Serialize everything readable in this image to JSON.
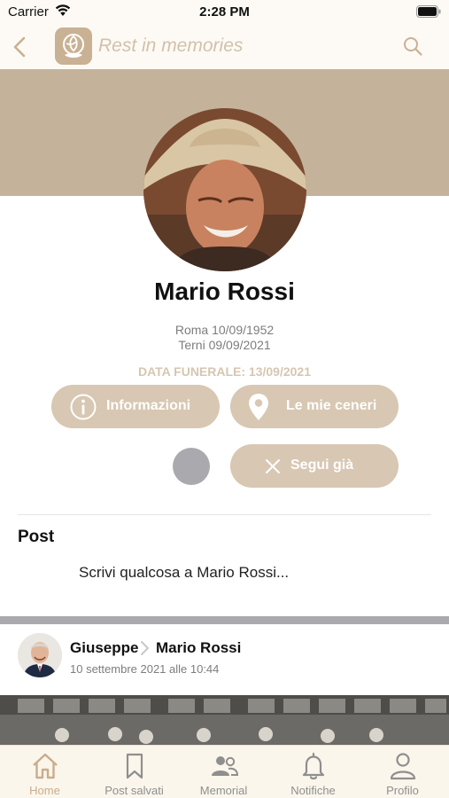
{
  "status_bar": {
    "carrier": "Carrier",
    "time": "2:28 PM"
  },
  "nav": {
    "title": "Rest in memories"
  },
  "profile": {
    "name": "Mario Rossi",
    "birth": "Roma 10/09/1952",
    "death": "Terni 09/09/2021",
    "funeral": "DATA FUNERALE: 13/09/2021"
  },
  "actions": {
    "info": "Informazioni",
    "ashes": "Le mie ceneri",
    "follow": "Segui già"
  },
  "post_section": {
    "heading": "Post",
    "prompt": "Scrivi qualcosa a Mario Rossi..."
  },
  "feed": {
    "author": "Giuseppe",
    "target": "Mario Rossi",
    "date": "10 settembre 2021 alle 10:44"
  },
  "tabs": [
    {
      "label": "Home",
      "icon": "home-icon",
      "active": true
    },
    {
      "label": "Post salvati",
      "icon": "bookmark-icon",
      "active": false
    },
    {
      "label": "Memorial",
      "icon": "people-icon",
      "active": false
    },
    {
      "label": "Notifiche",
      "icon": "bell-icon",
      "active": false
    },
    {
      "label": "Profilo",
      "icon": "person-icon",
      "active": false
    }
  ],
  "colors": {
    "accent": "#d8c7b2",
    "cover": "#c4b39a",
    "funeral_text": "#d6c6b1",
    "tab_active": "#c9ad8c",
    "tab_inactive": "#8f8f8f"
  }
}
